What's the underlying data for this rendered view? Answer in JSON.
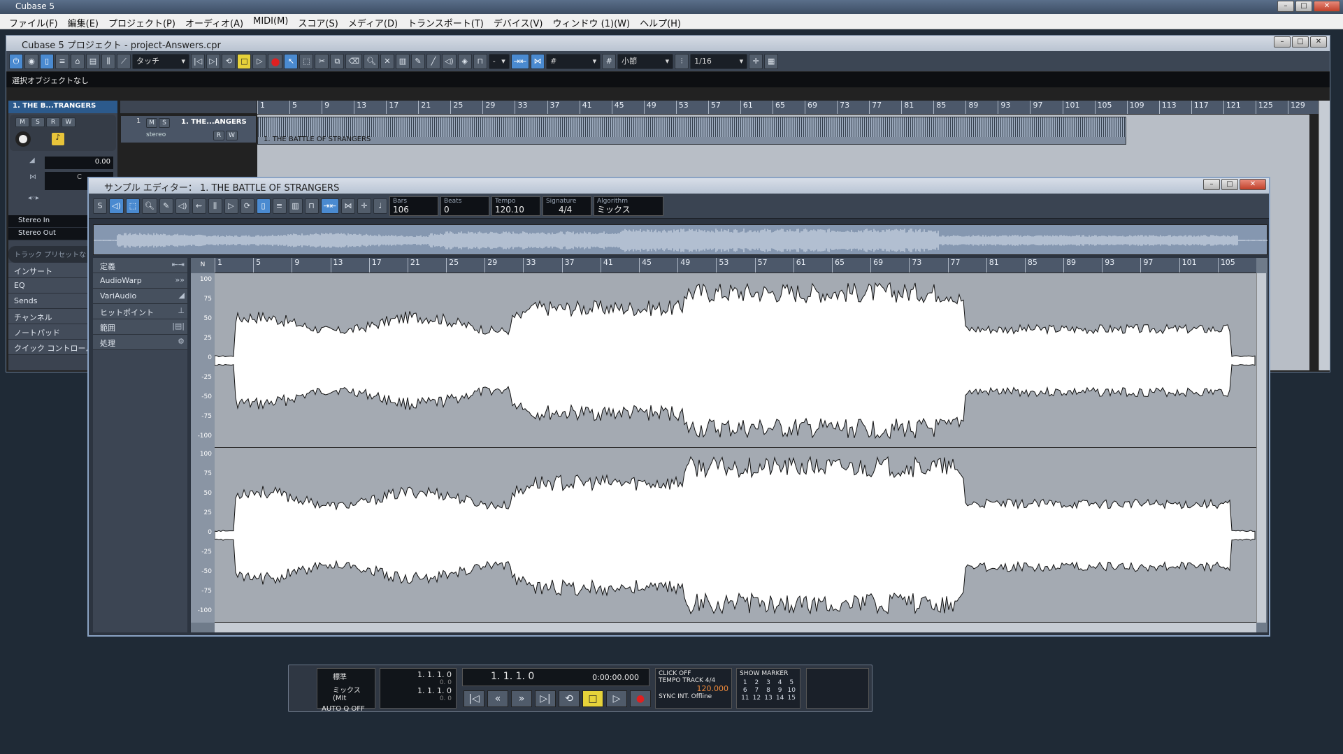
{
  "app": {
    "title": "Cubase 5"
  },
  "menu": [
    "ファイル(F)",
    "編集(E)",
    "プロジェクト(P)",
    "オーディオ(A)",
    "MIDI(M)",
    "スコア(S)",
    "メディア(D)",
    "トランスポート(T)",
    "デバイス(V)",
    "ウィンドウ (1)(W)",
    "ヘルプ(H)"
  ],
  "project": {
    "title": "Cubase 5 プロジェクト - project-Answers.cpr",
    "automation_mode": "タッチ",
    "snap_value": "小節",
    "quantize": "1/16",
    "status": "選択オブジェクトなし",
    "track_name_short": "1. THE B...TRANGERS",
    "track_row_name": "1. THE...ANGERS",
    "track_row_sub": "stereo",
    "event_name": "1. THE BATTLE OF STRANGERS",
    "volume": "0.00",
    "pan": "C",
    "input": "Stereo In",
    "output": "Stereo Out",
    "preset_placeholder": "トラック プリセットな",
    "sections": [
      "インサート",
      "EQ",
      "Sends",
      "チャンネル",
      "ノートパッド",
      "クイック コントロール"
    ],
    "ruler": [
      "1",
      "5",
      "9",
      "13",
      "17",
      "21",
      "25",
      "29",
      "33",
      "37",
      "41",
      "45",
      "49",
      "53",
      "57",
      "61",
      "65",
      "69",
      "73",
      "77",
      "81",
      "85",
      "89",
      "93",
      "97",
      "101",
      "105",
      "109",
      "113",
      "117",
      "121",
      "125",
      "129"
    ],
    "track_number": "1"
  },
  "editor": {
    "title": "サンプル エディター： 1. THE BATTLE OF STRANGERS",
    "bars_label": "Bars",
    "bars": "106",
    "beats_label": "Beats",
    "beats": "0",
    "tempo_label": "Tempo",
    "tempo": "120.10",
    "sig_label": "Signature",
    "sig": "4/4",
    "algo_label": "Algorithm",
    "algo": "ミックス",
    "sections": [
      {
        "label": "定義",
        "icon": "⇤⇥"
      },
      {
        "label": "AudioWarp",
        "icon": "»»"
      },
      {
        "label": "VariAudio",
        "icon": "◢"
      },
      {
        "label": "ヒットポイント",
        "icon": "⊥"
      },
      {
        "label": "範囲",
        "icon": "|▤|"
      },
      {
        "label": "処理",
        "icon": "⚙"
      }
    ],
    "ruler": [
      "1",
      "5",
      "9",
      "13",
      "17",
      "21",
      "25",
      "29",
      "33",
      "37",
      "41",
      "45",
      "49",
      "53",
      "57",
      "61",
      "65",
      "69",
      "73",
      "77",
      "81",
      "85",
      "89",
      "93",
      "97",
      "101",
      "105"
    ],
    "amp_labels": [
      "100",
      "75",
      "50",
      "25",
      "0",
      "-25",
      "-50",
      "-75",
      "-100"
    ],
    "corner": "N"
  },
  "transport": {
    "mode": "標準",
    "mix": "ミックス(MIt",
    "autoq": "AUTO Q",
    "autoq_val": "OFF",
    "left_locator": "1. 1. 1.   0",
    "left_sub": "0.   0",
    "right_locator": "1. 1. 1.   0",
    "right_sub": "0.   0",
    "position": "1. 1. 1.   0",
    "time": "0:00:00.000",
    "click": "CLICK",
    "click_val": "OFF",
    "tempo": "TEMPO",
    "track": "TRACK",
    "sig": "4/4",
    "tempo_val": "120.000",
    "sync": "SYNC",
    "int": "INT.",
    "offline": "Offline",
    "show": "SHOW",
    "marker": "MARKER",
    "markers": [
      "1",
      "2",
      "3",
      "4",
      "5",
      "6",
      "7",
      "8",
      "9",
      "10",
      "11",
      "12",
      "13",
      "14",
      "15"
    ]
  }
}
